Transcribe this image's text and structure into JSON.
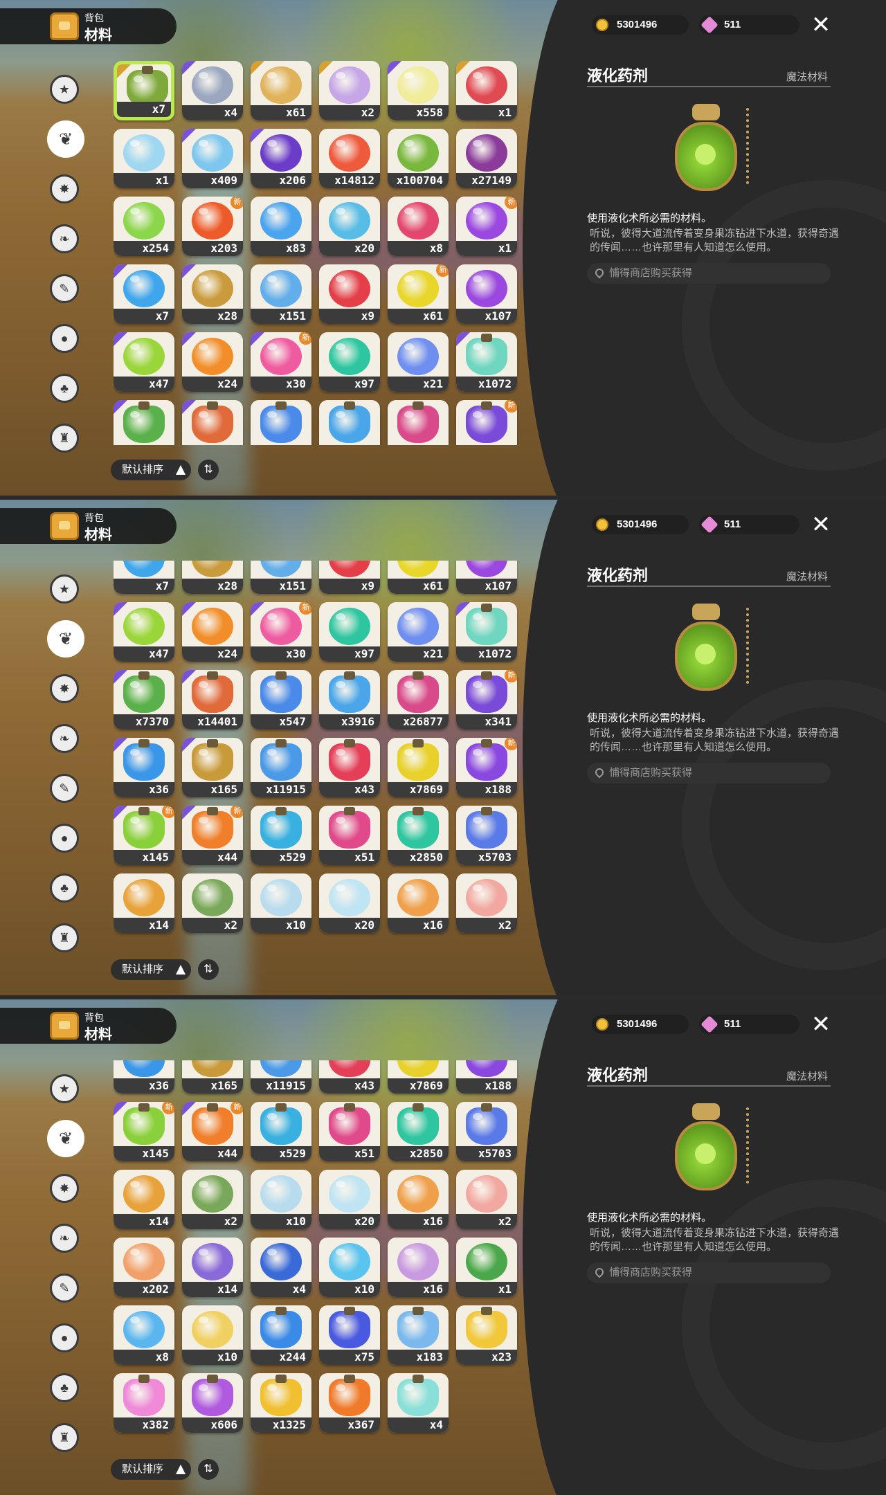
{
  "colors": {
    "accent_select": "#b9e94f",
    "rarity_purple": "#7a52d8",
    "rarity_gold": "#d8a02f",
    "panel_bg": "#292929",
    "new_badge": "#e88a2b"
  },
  "header": {
    "bag_label": "背包",
    "category_title": "材料"
  },
  "currency": {
    "gold": "5301496",
    "gems": "511"
  },
  "close_icon": "close-icon",
  "categories": [
    "star-icon",
    "leaf-icon",
    "burst-icon",
    "sprout-icon",
    "scroll-icon",
    "ball-icon",
    "acorn-icon",
    "furniture-icon"
  ],
  "sort": {
    "label": "默认排序",
    "order_icon": "⇅"
  },
  "detail": {
    "title": "液化药剂",
    "type": "魔法材料",
    "use": "使用液化术所必需的材料。",
    "flavor": "听说，彼得大道流传着变身果冻钻进下水道，获得奇遇的传闻……也许那里有人知道怎么使用。",
    "source": "悑得商店购买获得"
  },
  "new_badge_text": "新",
  "panels": [
    {
      "active_category": 1,
      "selected_index": 0,
      "scroll_offset": 0,
      "items": [
        {
          "q": "x7",
          "c": "#7fa93a",
          "r": "gold",
          "t": "bottle"
        },
        {
          "q": "x4",
          "c": "#9aa7bf",
          "r": "purple"
        },
        {
          "q": "x61",
          "c": "#e0b25a",
          "r": "gold"
        },
        {
          "q": "x2",
          "c": "#c6a6e6",
          "r": "gold"
        },
        {
          "q": "x558",
          "c": "#f1ec99",
          "r": "purple"
        },
        {
          "q": "x1",
          "c": "#e04a52",
          "r": "gold"
        },
        {
          "q": "x1",
          "c": "#9fd7f1"
        },
        {
          "q": "x409",
          "c": "#7dc7ee",
          "r": "purple"
        },
        {
          "q": "x206",
          "c": "#6a3cc8",
          "r": "purple"
        },
        {
          "q": "x14812",
          "c": "#ee5a3c"
        },
        {
          "q": "x100704",
          "c": "#78b83c"
        },
        {
          "q": "x27149",
          "c": "#8b3c9a"
        },
        {
          "q": "x254",
          "c": "#8cd64b"
        },
        {
          "q": "x203",
          "c": "#ee5b2a",
          "n": true
        },
        {
          "q": "x83",
          "c": "#4ba4ee"
        },
        {
          "q": "x20",
          "c": "#58bde6"
        },
        {
          "q": "x8",
          "c": "#e4476e"
        },
        {
          "q": "x1",
          "c": "#9a48e0",
          "n": true
        },
        {
          "q": "x7",
          "c": "#3fa6ec",
          "r": "purple"
        },
        {
          "q": "x28",
          "c": "#c99b3c",
          "r": "purple"
        },
        {
          "q": "x151",
          "c": "#62aeea"
        },
        {
          "q": "x9",
          "c": "#e43e48"
        },
        {
          "q": "x61",
          "c": "#e8d72a",
          "n": true
        },
        {
          "q": "x107",
          "c": "#9a48e0"
        },
        {
          "q": "x47",
          "c": "#9ad63a",
          "r": "purple"
        },
        {
          "q": "x24",
          "c": "#f28e2a",
          "r": "purple"
        },
        {
          "q": "x30",
          "c": "#ef5ba0",
          "r": "purple",
          "n": true
        },
        {
          "q": "x97",
          "c": "#2ec6a0"
        },
        {
          "q": "x21",
          "c": "#6e8ff0"
        },
        {
          "q": "x1072",
          "c": "#6fd6c0",
          "r": "purple",
          "t": "bottle"
        },
        {
          "q": "",
          "c": "#5ab04a",
          "r": "purple",
          "t": "bottle"
        },
        {
          "q": "",
          "c": "#e06a3a",
          "r": "purple",
          "t": "bottle"
        },
        {
          "q": "",
          "c": "#4a8ae8",
          "t": "bottle"
        },
        {
          "q": "",
          "c": "#4aa6e8",
          "t": "bottle"
        },
        {
          "q": "",
          "c": "#d84a8a",
          "t": "bottle"
        },
        {
          "q": "",
          "c": "#7a4ad8",
          "t": "bottle",
          "n": true
        }
      ]
    },
    {
      "active_category": 1,
      "selected_index": -1,
      "scroll_offset": 0,
      "items": [
        {
          "q": "x7",
          "c": "#3fa6ec",
          "r": "purple"
        },
        {
          "q": "x28",
          "c": "#c99b3c",
          "r": "purple"
        },
        {
          "q": "x151",
          "c": "#62aeea"
        },
        {
          "q": "x9",
          "c": "#e43e48"
        },
        {
          "q": "x61",
          "c": "#e8d72a"
        },
        {
          "q": "x107",
          "c": "#9a48e0"
        },
        {
          "q": "x47",
          "c": "#9ad63a",
          "r": "purple"
        },
        {
          "q": "x24",
          "c": "#f28e2a",
          "r": "purple"
        },
        {
          "q": "x30",
          "c": "#ef5ba0",
          "r": "purple",
          "n": true
        },
        {
          "q": "x97",
          "c": "#2ec6a0"
        },
        {
          "q": "x21",
          "c": "#6e8ff0"
        },
        {
          "q": "x1072",
          "c": "#6fd6c0",
          "r": "purple",
          "t": "bottle"
        },
        {
          "q": "x7370",
          "c": "#5ab04a",
          "r": "purple",
          "t": "bottle"
        },
        {
          "q": "x14401",
          "c": "#e06a3a",
          "r": "purple",
          "t": "bottle"
        },
        {
          "q": "x547",
          "c": "#4a8ae8",
          "t": "bottle"
        },
        {
          "q": "x3916",
          "c": "#4aa6e8",
          "t": "bottle"
        },
        {
          "q": "x26877",
          "c": "#d84a8a",
          "t": "bottle"
        },
        {
          "q": "x341",
          "c": "#7a4ad8",
          "t": "bottle",
          "n": true
        },
        {
          "q": "x36",
          "c": "#3a96e8",
          "r": "purple",
          "t": "bottle"
        },
        {
          "q": "x165",
          "c": "#c89a3a",
          "r": "purple",
          "t": "bottle"
        },
        {
          "q": "x11915",
          "c": "#4a9ae8",
          "t": "bottle"
        },
        {
          "q": "x43",
          "c": "#e43e58",
          "t": "bottle"
        },
        {
          "q": "x7869",
          "c": "#e8d12a",
          "t": "bottle"
        },
        {
          "q": "x188",
          "c": "#8a48e0",
          "t": "bottle",
          "n": true
        },
        {
          "q": "x145",
          "c": "#8ad03a",
          "r": "purple",
          "t": "bottle",
          "n": true
        },
        {
          "q": "x44",
          "c": "#f07e2a",
          "r": "purple",
          "t": "bottle",
          "n": true
        },
        {
          "q": "x529",
          "c": "#38b0e0",
          "t": "bottle"
        },
        {
          "q": "x51",
          "c": "#e04a8a",
          "t": "bottle"
        },
        {
          "q": "x2850",
          "c": "#2ec6a0",
          "t": "bottle"
        },
        {
          "q": "x5703",
          "c": "#5a7ae8",
          "t": "bottle"
        },
        {
          "q": "x14",
          "c": "#e8a23a"
        },
        {
          "q": "x2",
          "c": "#7aa85a"
        },
        {
          "q": "x10",
          "c": "#b8dcee"
        },
        {
          "q": "x20",
          "c": "#bfe4f2"
        },
        {
          "q": "x16",
          "c": "#f0a04a"
        },
        {
          "q": "x2",
          "c": "#f2a8a0"
        }
      ]
    },
    {
      "active_category": 1,
      "selected_index": -1,
      "scroll_offset": 0,
      "items": [
        {
          "q": "x36",
          "c": "#3a96e8",
          "r": "purple",
          "t": "bottle"
        },
        {
          "q": "x165",
          "c": "#c89a3a",
          "r": "purple",
          "t": "bottle"
        },
        {
          "q": "x11915",
          "c": "#4a9ae8",
          "t": "bottle"
        },
        {
          "q": "x43",
          "c": "#e43e58",
          "t": "bottle"
        },
        {
          "q": "x7869",
          "c": "#e8d12a",
          "t": "bottle"
        },
        {
          "q": "x188",
          "c": "#8a48e0",
          "t": "bottle"
        },
        {
          "q": "x145",
          "c": "#8ad03a",
          "r": "purple",
          "t": "bottle",
          "n": true
        },
        {
          "q": "x44",
          "c": "#f07e2a",
          "r": "purple",
          "t": "bottle",
          "n": true
        },
        {
          "q": "x529",
          "c": "#38b0e0",
          "t": "bottle"
        },
        {
          "q": "x51",
          "c": "#e04a8a",
          "t": "bottle"
        },
        {
          "q": "x2850",
          "c": "#2ec6a0",
          "t": "bottle"
        },
        {
          "q": "x5703",
          "c": "#5a7ae8",
          "t": "bottle"
        },
        {
          "q": "x14",
          "c": "#e8a23a"
        },
        {
          "q": "x2",
          "c": "#7aa85a"
        },
        {
          "q": "x10",
          "c": "#b8dcee"
        },
        {
          "q": "x20",
          "c": "#bfe4f2"
        },
        {
          "q": "x16",
          "c": "#f0a04a"
        },
        {
          "q": "x2",
          "c": "#f2a8a0"
        },
        {
          "q": "x202",
          "c": "#f2a06a"
        },
        {
          "q": "x14",
          "c": "#8a6ad8"
        },
        {
          "q": "x4",
          "c": "#3a6ad8"
        },
        {
          "q": "x10",
          "c": "#5ac4ee"
        },
        {
          "q": "x16",
          "c": "#c89ae0"
        },
        {
          "q": "x1",
          "c": "#4aa84a"
        },
        {
          "q": "x8",
          "c": "#5ab6ee"
        },
        {
          "q": "x10",
          "c": "#f0d060"
        },
        {
          "q": "x244",
          "c": "#3a8ae8",
          "t": "bottle"
        },
        {
          "q": "x75",
          "c": "#4a5ae0",
          "t": "bottle"
        },
        {
          "q": "x183",
          "c": "#7ab8ee",
          "t": "bottle"
        },
        {
          "q": "x23",
          "c": "#f0c83a",
          "t": "bottle"
        },
        {
          "q": "x382",
          "c": "#f08ad8",
          "t": "bottle"
        },
        {
          "q": "x606",
          "c": "#b05ae0",
          "t": "bottle"
        },
        {
          "q": "x1325",
          "c": "#f0c030",
          "t": "bottle"
        },
        {
          "q": "x367",
          "c": "#f07a2a",
          "t": "bottle"
        },
        {
          "q": "x4",
          "c": "#8ae0d8",
          "t": "bottle"
        }
      ]
    }
  ]
}
